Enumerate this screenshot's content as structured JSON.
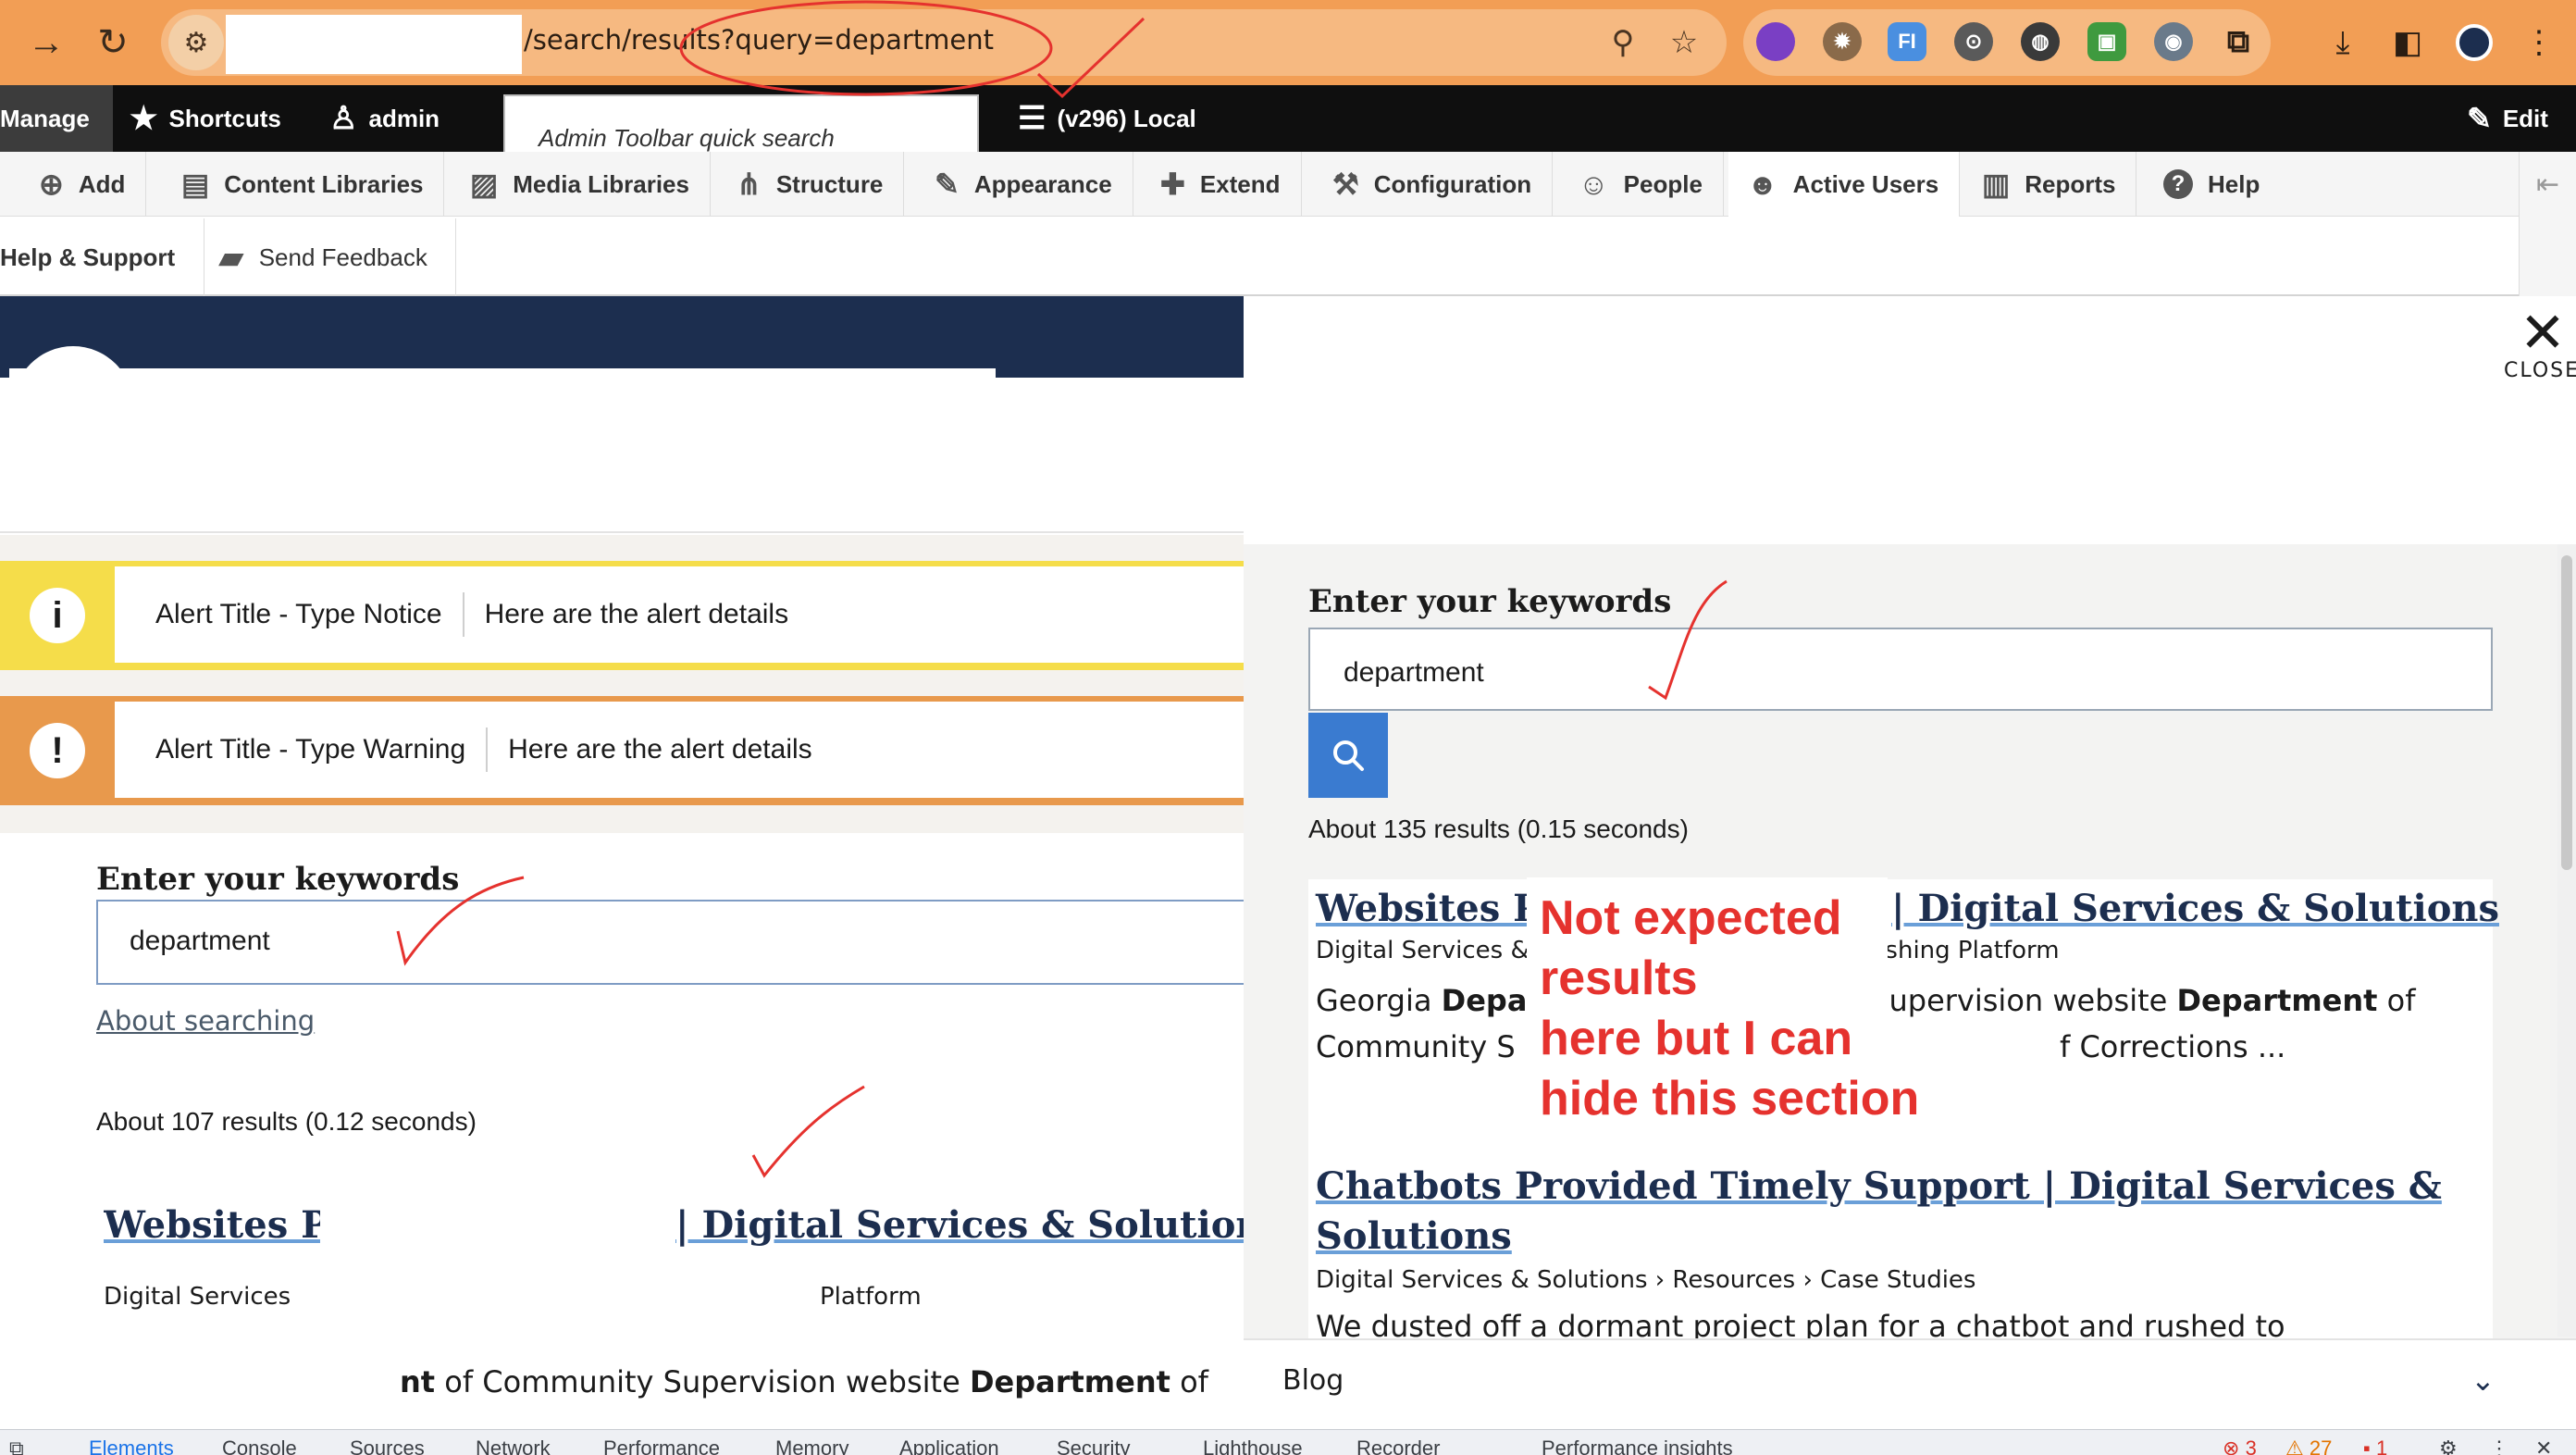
{
  "browser": {
    "url": "/search/results?query=department",
    "extensions": [
      {
        "name": "color-circle-icon",
        "label": "",
        "color": "#7a3fc4"
      },
      {
        "name": "gear-extension-icon",
        "label": "",
        "color": "#8a6a4a"
      },
      {
        "name": "fi-extension-icon",
        "label": "FI",
        "color": "#4a8fe0"
      },
      {
        "name": "lock-extension-icon",
        "label": "",
        "color": "#5a5a5a"
      },
      {
        "name": "ring-extension-icon",
        "label": "",
        "color": "#3a3a3a"
      },
      {
        "name": "green-extension-icon",
        "label": "",
        "color": "#3f9a3f"
      },
      {
        "name": "eye-extension-icon",
        "label": "",
        "color": "#6a7a8a"
      },
      {
        "name": "puzzle-extension-icon",
        "label": "",
        "color": "#2a1d12"
      }
    ]
  },
  "toolbar": {
    "manage": "Manage",
    "shortcuts": "Shortcuts",
    "user": "admin",
    "quick_search_placeholder": "Admin Toolbar quick search",
    "env": "(v296) Local",
    "edit": "Edit"
  },
  "tray": {
    "items": [
      {
        "label": "Add",
        "icon": "⊕"
      },
      {
        "label": "Content Libraries",
        "icon": "▤"
      },
      {
        "label": "Media Libraries",
        "icon": "▨"
      },
      {
        "label": "Structure",
        "icon": "⋔"
      },
      {
        "label": "Appearance",
        "icon": "✎"
      },
      {
        "label": "Extend",
        "icon": "✚"
      },
      {
        "label": "Configuration",
        "icon": "⚒"
      },
      {
        "label": "People",
        "icon": "☺"
      },
      {
        "label": "Active Users",
        "icon": "☻"
      },
      {
        "label": "Reports",
        "icon": "▥"
      },
      {
        "label": "Help",
        "icon": "?"
      }
    ],
    "row2": {
      "help_support": "Help & Support",
      "send_feedback": "Send Feedback"
    }
  },
  "alerts": [
    {
      "title": "Alert Title - Type Notice",
      "details": "Here are the alert details",
      "icon": "i",
      "color": "#f5dd4a"
    },
    {
      "title": "Alert Title - Type Warning",
      "details": "Here are the alert details",
      "icon": "!",
      "color": "#e8994c"
    }
  ],
  "left": {
    "keywords_label": "Enter your keywords",
    "input_value": "department",
    "about_link": "About searching",
    "result_count": "About 107 results (0.12 seconds)",
    "result_title_start": "Websites Pc",
    "result_title_end": "| Digital Services & Solutions",
    "crumb_start": "Digital Services",
    "crumb_end": "Platform",
    "snippet_bold1": "nt",
    "snippet_mid": " of Community Supervision website ",
    "snippet_bold2": "Department",
    "snippet_end": " of"
  },
  "right": {
    "close_label": "CLOSE",
    "keywords_label": "Enter your keywords",
    "input_value": "department",
    "result_count": "About 135 results (0.15 seconds)",
    "results": [
      {
        "title_start": "Websites P",
        "title_end": "| Digital Services & Solutions",
        "crumb_start": "Digital Services & Solutions › Services › Gov",
        "crumb_end": "b Publishing Platform",
        "snippet1_start": "Georgia ",
        "snippet1_bold": "Department",
        "snippet1_end": " of Community Supervision website ",
        "snippet1_bold2": "Department",
        "snippet1_tail": " of",
        "snippet2_start": "Community S",
        "snippet2_end": "f Corrections ..."
      },
      {
        "title_line1": "Chatbots Provided Timely Support | Digital Services &",
        "title_line2": "Solutions",
        "crumb": "Digital Services & Solutions › Resources › Case Studies",
        "snippet": "We dusted off a dormant project plan for a chatbot and rushed to"
      }
    ],
    "blog_label": "Blog"
  },
  "annotation": {
    "lines": [
      "Not expected",
      "results",
      "here but I can",
      "hide this section"
    ],
    "color": "#e5322e"
  },
  "devtools": {
    "tabs": [
      "Elements",
      "Console",
      "Sources",
      "Network",
      "Performance",
      "Memory",
      "Application",
      "Security",
      "Lighthouse",
      "Recorder",
      "Performance insights"
    ],
    "errors": "3",
    "warnings": "27",
    "info": "1"
  }
}
